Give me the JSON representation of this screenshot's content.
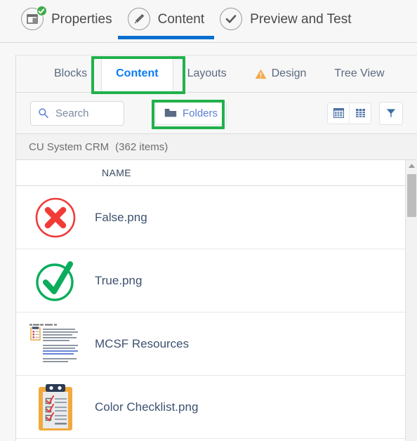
{
  "wizard": {
    "steps": [
      {
        "label": "Properties",
        "icon": "layout-window-icon",
        "badge": "green-check-badge",
        "active": false
      },
      {
        "label": "Content",
        "icon": "pencil-icon",
        "badge": "",
        "active": true
      },
      {
        "label": "Preview and Test",
        "icon": "check-circle-icon",
        "badge": "",
        "active": false
      }
    ],
    "active_underline_color": "#0a6ed1",
    "badge_color": "#3fab4b"
  },
  "tabs": [
    {
      "label": "Blocks",
      "icon": "",
      "selected": false
    },
    {
      "label": "Content",
      "icon": "",
      "selected": true
    },
    {
      "label": "Layouts",
      "icon": "",
      "selected": false
    },
    {
      "label": "Design",
      "icon": "warning-triangle-icon",
      "selected": false
    },
    {
      "label": "Tree View",
      "icon": "",
      "selected": false
    }
  ],
  "tab_selected_color": "#0a7cf5",
  "toolbar": {
    "search": {
      "placeholder": "Search",
      "value": "",
      "icon": "search-icon"
    },
    "folders": {
      "label": "Folders",
      "icon": "folder-icon"
    },
    "view_table": {
      "icon": "table-view-icon"
    },
    "view_grid": {
      "icon": "grid-view-icon"
    },
    "filter": {
      "icon": "filter-funnel-icon"
    }
  },
  "breadcrumb": {
    "title": "CU System CRM",
    "count": "(362 items)"
  },
  "table": {
    "columns": [
      "NAME"
    ],
    "rows": [
      {
        "name": "False.png",
        "thumb": "red-cross-circle-icon"
      },
      {
        "name": "True.png",
        "thumb": "green-check-circle-icon"
      },
      {
        "name": "MCSF Resources",
        "thumb": "document-page-icon"
      },
      {
        "name": "Color Checklist.png",
        "thumb": "orange-clipboard-icon"
      }
    ]
  },
  "scrollbar": {
    "up_arrow": "scroll-up-arrow-icon"
  },
  "annotations": [
    {
      "name": "content-tab-highlight",
      "color": "#22b14c"
    },
    {
      "name": "folders-button-highlight",
      "color": "#22b14c"
    }
  ]
}
